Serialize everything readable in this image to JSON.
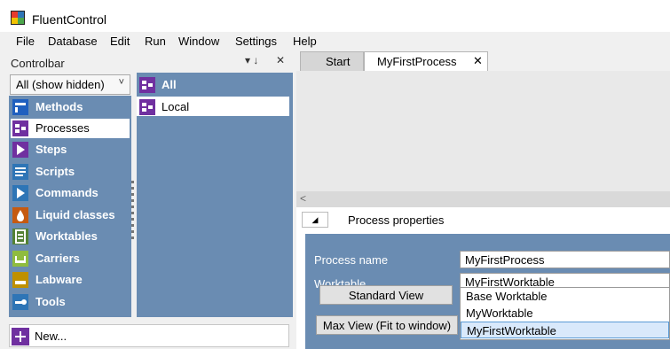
{
  "app": {
    "title": "FluentControl"
  },
  "menu": [
    "File",
    "Database",
    "Edit",
    "Run",
    "Window",
    "Settings",
    "Help"
  ],
  "controlbar": {
    "title": "Controlbar",
    "pin_glyph": "▾ ↓",
    "close_glyph": "✕",
    "filter_value": "All (show hidden)",
    "categories": [
      {
        "label": "Methods",
        "icon": "methods-icon",
        "color": "#1f5fbf"
      },
      {
        "label": "Processes",
        "icon": "processes-icon",
        "color": "#7030a0"
      },
      {
        "label": "Steps",
        "icon": "steps-icon",
        "color": "#7030a0"
      },
      {
        "label": "Scripts",
        "icon": "scripts-icon",
        "color": "#2e75b6"
      },
      {
        "label": "Commands",
        "icon": "commands-icon",
        "color": "#2e75b6"
      },
      {
        "label": "Liquid classes",
        "icon": "liquid-classes-icon",
        "color": "#c55a11"
      },
      {
        "label": "Worktables",
        "icon": "worktables-icon",
        "color": "#548235"
      },
      {
        "label": "Carriers",
        "icon": "carriers-icon",
        "color": "#8fbc3f"
      },
      {
        "label": "Labware",
        "icon": "labware-icon",
        "color": "#bf9000"
      },
      {
        "label": "Tools",
        "icon": "tools-icon",
        "color": "#2e75b6"
      }
    ],
    "selected_category": "Processes",
    "groups": [
      {
        "label": "All"
      },
      {
        "label": "Local"
      }
    ],
    "selected_group": "Local",
    "new_label": "New..."
  },
  "tabs": [
    {
      "label": "Start"
    },
    {
      "label": "MyFirstProcess",
      "close": "✕"
    }
  ],
  "process_properties": {
    "title": "Process properties",
    "toggle_glyph": "◢",
    "process_name_label": "Process name",
    "process_name_value": "MyFirstProcess",
    "worktable_label": "Worktable",
    "worktable_value": "MyFirstWorktable",
    "worktable_options": [
      "Base Worktable",
      "MyWorktable",
      "MyFirstWorktable"
    ],
    "selected_option": "MyFirstWorktable",
    "standard_view_label": "Standard View",
    "max_view_label": "Max View (Fit to window)"
  },
  "colors": {
    "panel_blue": "#6a8cb2",
    "purple_accent": "#7030a0",
    "selection_blue": "#d9e9fb"
  }
}
